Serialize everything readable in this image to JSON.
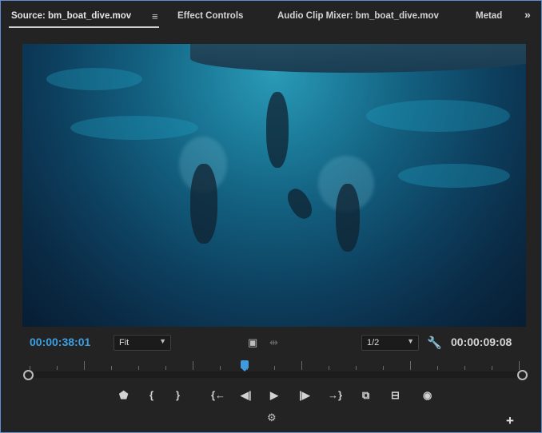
{
  "tabs": [
    {
      "label": "Source: bm_boat_dive.mov",
      "active": true
    },
    {
      "label": "Effect Controls"
    },
    {
      "label": "Audio Clip Mixer: bm_boat_dive.mov"
    },
    {
      "label": "Metad"
    }
  ],
  "icons": {
    "panel_menu": "≡",
    "overflow": "»",
    "safe_margins": "▣",
    "insert_marker": "⇹",
    "wrench": "🔧",
    "settings": "⚙",
    "add": "+"
  },
  "viewer": {
    "current_time": "00:00:38:01",
    "duration": "00:00:09:08",
    "zoom_select": "Fit",
    "resolution_select": "1/2",
    "playhead_fraction": 0.44
  },
  "transport": [
    {
      "name": "add-marker-button",
      "glyph": "⬟"
    },
    {
      "name": "mark-in-button",
      "glyph": "{"
    },
    {
      "name": "mark-out-button",
      "glyph": "}"
    },
    {
      "name": "go-to-in-button",
      "glyph": "{←"
    },
    {
      "name": "step-back-button",
      "glyph": "◀|"
    },
    {
      "name": "play-button",
      "glyph": "▶"
    },
    {
      "name": "step-forward-button",
      "glyph": "|▶"
    },
    {
      "name": "go-to-out-button",
      "glyph": "→}"
    },
    {
      "name": "insert-button",
      "glyph": "⧉"
    },
    {
      "name": "overwrite-button",
      "glyph": "⊟"
    },
    {
      "name": "export-frame-button",
      "glyph": "◉"
    }
  ],
  "colors": {
    "timecode_accent": "#3aa0e4",
    "panel_border": "#5b8fd6",
    "background": "#232323"
  }
}
